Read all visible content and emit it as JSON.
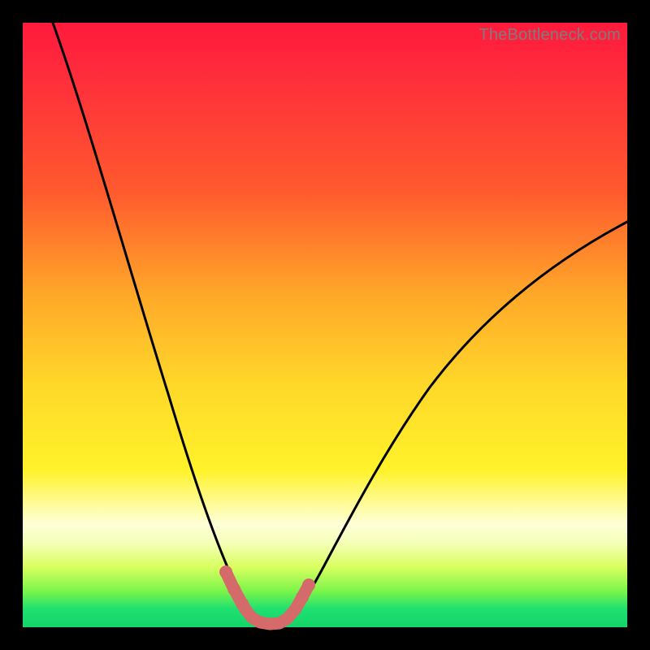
{
  "watermark": "TheBottleneck.com",
  "colors": {
    "frame": "#000000",
    "top": "#ff1a3c",
    "mid": "#ffd829",
    "bottom": "#14d46a",
    "curve": "#000000",
    "highlight": "#d46a6a"
  },
  "chart_data": {
    "type": "line",
    "title": "",
    "xlabel": "",
    "ylabel": "",
    "xlim": [
      0,
      100
    ],
    "ylim": [
      0,
      100
    ],
    "grid": false,
    "legend": false,
    "series": [
      {
        "name": "bottleneck-curve",
        "x": [
          5,
          10,
          15,
          20,
          25,
          30,
          33,
          35,
          37,
          40,
          43,
          45,
          50,
          55,
          60,
          70,
          80,
          90,
          100
        ],
        "y": [
          100,
          85,
          70,
          55,
          40,
          22,
          10,
          4,
          1,
          0,
          0,
          2,
          8,
          15,
          22,
          33,
          42,
          49,
          55
        ]
      },
      {
        "name": "optimal-region-highlight",
        "x": [
          33,
          35,
          37,
          40,
          43,
          45
        ],
        "y": [
          9,
          3,
          1,
          0,
          1,
          3
        ]
      }
    ],
    "annotations": []
  }
}
